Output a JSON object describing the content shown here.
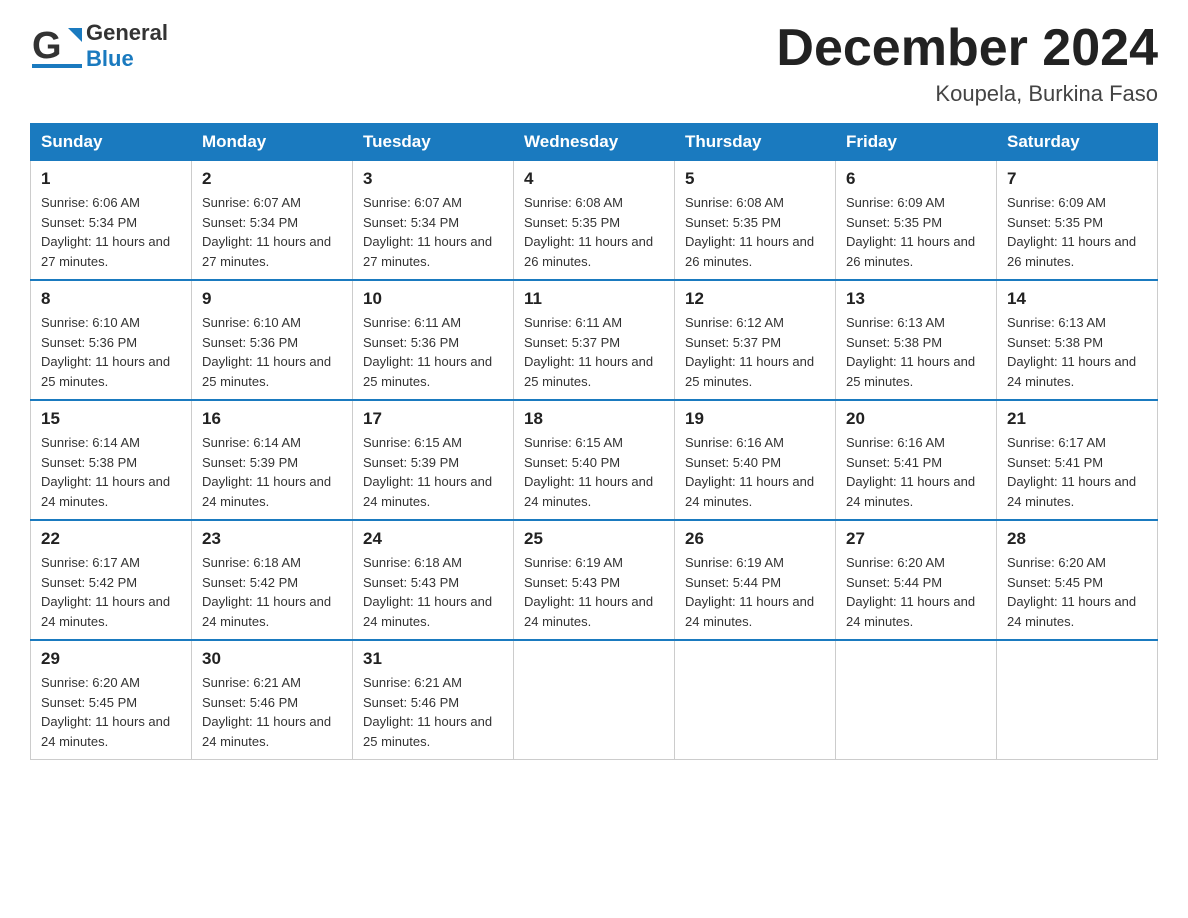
{
  "header": {
    "logo_general": "General",
    "logo_blue": "Blue",
    "month_title": "December 2024",
    "location": "Koupela, Burkina Faso"
  },
  "days_of_week": [
    "Sunday",
    "Monday",
    "Tuesday",
    "Wednesday",
    "Thursday",
    "Friday",
    "Saturday"
  ],
  "weeks": [
    [
      {
        "day": "1",
        "sunrise": "6:06 AM",
        "sunset": "5:34 PM",
        "daylight": "11 hours and 27 minutes."
      },
      {
        "day": "2",
        "sunrise": "6:07 AM",
        "sunset": "5:34 PM",
        "daylight": "11 hours and 27 minutes."
      },
      {
        "day": "3",
        "sunrise": "6:07 AM",
        "sunset": "5:34 PM",
        "daylight": "11 hours and 27 minutes."
      },
      {
        "day": "4",
        "sunrise": "6:08 AM",
        "sunset": "5:35 PM",
        "daylight": "11 hours and 26 minutes."
      },
      {
        "day": "5",
        "sunrise": "6:08 AM",
        "sunset": "5:35 PM",
        "daylight": "11 hours and 26 minutes."
      },
      {
        "day": "6",
        "sunrise": "6:09 AM",
        "sunset": "5:35 PM",
        "daylight": "11 hours and 26 minutes."
      },
      {
        "day": "7",
        "sunrise": "6:09 AM",
        "sunset": "5:35 PM",
        "daylight": "11 hours and 26 minutes."
      }
    ],
    [
      {
        "day": "8",
        "sunrise": "6:10 AM",
        "sunset": "5:36 PM",
        "daylight": "11 hours and 25 minutes."
      },
      {
        "day": "9",
        "sunrise": "6:10 AM",
        "sunset": "5:36 PM",
        "daylight": "11 hours and 25 minutes."
      },
      {
        "day": "10",
        "sunrise": "6:11 AM",
        "sunset": "5:36 PM",
        "daylight": "11 hours and 25 minutes."
      },
      {
        "day": "11",
        "sunrise": "6:11 AM",
        "sunset": "5:37 PM",
        "daylight": "11 hours and 25 minutes."
      },
      {
        "day": "12",
        "sunrise": "6:12 AM",
        "sunset": "5:37 PM",
        "daylight": "11 hours and 25 minutes."
      },
      {
        "day": "13",
        "sunrise": "6:13 AM",
        "sunset": "5:38 PM",
        "daylight": "11 hours and 25 minutes."
      },
      {
        "day": "14",
        "sunrise": "6:13 AM",
        "sunset": "5:38 PM",
        "daylight": "11 hours and 24 minutes."
      }
    ],
    [
      {
        "day": "15",
        "sunrise": "6:14 AM",
        "sunset": "5:38 PM",
        "daylight": "11 hours and 24 minutes."
      },
      {
        "day": "16",
        "sunrise": "6:14 AM",
        "sunset": "5:39 PM",
        "daylight": "11 hours and 24 minutes."
      },
      {
        "day": "17",
        "sunrise": "6:15 AM",
        "sunset": "5:39 PM",
        "daylight": "11 hours and 24 minutes."
      },
      {
        "day": "18",
        "sunrise": "6:15 AM",
        "sunset": "5:40 PM",
        "daylight": "11 hours and 24 minutes."
      },
      {
        "day": "19",
        "sunrise": "6:16 AM",
        "sunset": "5:40 PM",
        "daylight": "11 hours and 24 minutes."
      },
      {
        "day": "20",
        "sunrise": "6:16 AM",
        "sunset": "5:41 PM",
        "daylight": "11 hours and 24 minutes."
      },
      {
        "day": "21",
        "sunrise": "6:17 AM",
        "sunset": "5:41 PM",
        "daylight": "11 hours and 24 minutes."
      }
    ],
    [
      {
        "day": "22",
        "sunrise": "6:17 AM",
        "sunset": "5:42 PM",
        "daylight": "11 hours and 24 minutes."
      },
      {
        "day": "23",
        "sunrise": "6:18 AM",
        "sunset": "5:42 PM",
        "daylight": "11 hours and 24 minutes."
      },
      {
        "day": "24",
        "sunrise": "6:18 AM",
        "sunset": "5:43 PM",
        "daylight": "11 hours and 24 minutes."
      },
      {
        "day": "25",
        "sunrise": "6:19 AM",
        "sunset": "5:43 PM",
        "daylight": "11 hours and 24 minutes."
      },
      {
        "day": "26",
        "sunrise": "6:19 AM",
        "sunset": "5:44 PM",
        "daylight": "11 hours and 24 minutes."
      },
      {
        "day": "27",
        "sunrise": "6:20 AM",
        "sunset": "5:44 PM",
        "daylight": "11 hours and 24 minutes."
      },
      {
        "day": "28",
        "sunrise": "6:20 AM",
        "sunset": "5:45 PM",
        "daylight": "11 hours and 24 minutes."
      }
    ],
    [
      {
        "day": "29",
        "sunrise": "6:20 AM",
        "sunset": "5:45 PM",
        "daylight": "11 hours and 24 minutes."
      },
      {
        "day": "30",
        "sunrise": "6:21 AM",
        "sunset": "5:46 PM",
        "daylight": "11 hours and 24 minutes."
      },
      {
        "day": "31",
        "sunrise": "6:21 AM",
        "sunset": "5:46 PM",
        "daylight": "11 hours and 25 minutes."
      },
      null,
      null,
      null,
      null
    ]
  ],
  "colors": {
    "header_bg": "#1a7abf",
    "header_text": "#ffffff",
    "border": "#1a7abf",
    "cell_border": "#cccccc"
  }
}
